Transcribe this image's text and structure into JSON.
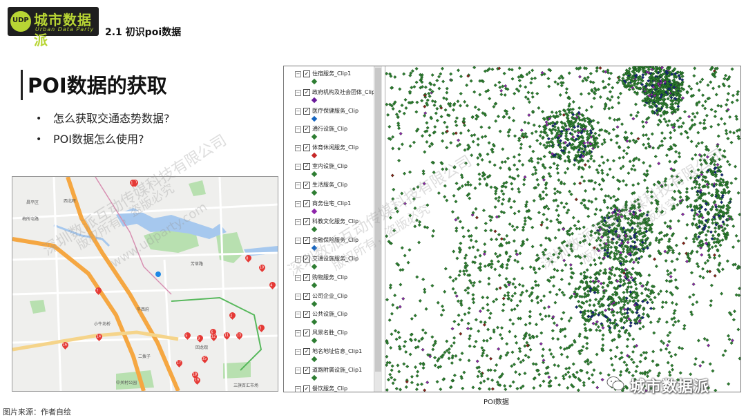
{
  "header": {
    "logo_text": "城市数据派",
    "logo_subtext": "Urban Data Party",
    "logo_badge": "UDP",
    "section_title": "2.1 初识poi数据"
  },
  "main": {
    "title": "POI数据的获取",
    "bullets": [
      "怎么获取交通态势数据?",
      "POI数据怎么使用?"
    ]
  },
  "map": {
    "road_labels": [
      "芳草路",
      "平西府",
      "二拨子",
      "回龙观",
      "中关村公园",
      "小牛坊桥",
      "三旗百汇市场",
      "西北旺",
      "梅所屯路",
      "昌平区"
    ],
    "markers": [
      "7",
      "8",
      "10",
      "4",
      "2",
      "3",
      "5",
      "9",
      "6",
      "12",
      "11",
      "13",
      "15",
      "16",
      "14",
      "17",
      "18",
      "19",
      "20",
      "1"
    ]
  },
  "poi_panel": {
    "layers": [
      {
        "label": "住宿服务_Clip1",
        "color": "#2e7d32"
      },
      {
        "label": "政府机构及社会团体_Clip",
        "color": "#6a1b9a"
      },
      {
        "label": "医疗保健服务_Clip",
        "color": "#1565c0"
      },
      {
        "label": "通行设施_Clip",
        "color": "#2e7d32"
      },
      {
        "label": "体育休闲服务_Clip",
        "color": "#c62828"
      },
      {
        "label": "室内设施_Clip",
        "color": "#2e7d32"
      },
      {
        "label": "生活服务_Clip",
        "color": "#2e7d32"
      },
      {
        "label": "商务住宅_Clip1",
        "color": "#8e24aa"
      },
      {
        "label": "科教文化服务_Clip",
        "color": "#2e7d32"
      },
      {
        "label": "金融保险服务_Clip",
        "color": "#1565c0"
      },
      {
        "label": "交通设施服务_Clip",
        "color": "#2e7d32"
      },
      {
        "label": "购物服务_Clip",
        "color": "#2e7d32"
      },
      {
        "label": "公司企业_Clip",
        "color": "#2e7d32"
      },
      {
        "label": "公共设施_Clip",
        "color": "#2e7d32"
      },
      {
        "label": "风景名胜_Clip",
        "color": "#2e7d32"
      },
      {
        "label": "地名地址信息_Clip1",
        "color": "#2e7d32"
      },
      {
        "label": "道路附属设施_Clip1",
        "color": "#2e7d32"
      },
      {
        "label": "餐饮服务_Clip",
        "color": "#2e7d32"
      }
    ],
    "caption": "POI数据"
  },
  "footer": {
    "source": "图片来源：作者自绘",
    "wechat_label": "城市数据派"
  },
  "watermarks": [
    "深圳数派互动传媒科技有限公司",
    "版权所有，盗版必究",
    "www.udparty.com"
  ],
  "colors": {
    "accent": "#b8d534",
    "poi_green": "#2e7d32",
    "poi_purple": "#8e24aa",
    "poi_blue": "#1a237e",
    "marker_red": "#e53935",
    "map_water": "#a6c8ee",
    "map_green": "#b8e0b0",
    "road_orange": "#f5a742"
  }
}
